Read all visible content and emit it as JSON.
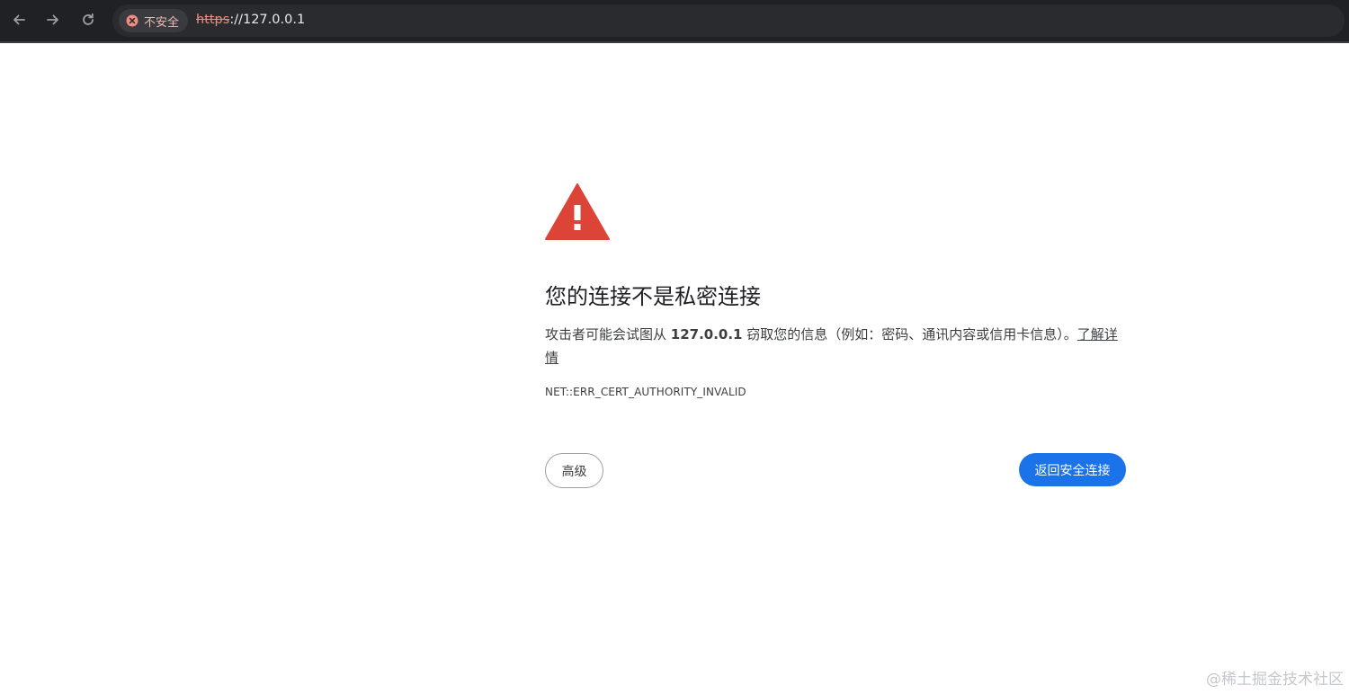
{
  "browser": {
    "security_label": "不安全",
    "url_scheme": "https",
    "url_separator": "://",
    "url_host": "127.0.0.1"
  },
  "page": {
    "heading": "您的连接不是私密连接",
    "desc_before": "攻击者可能会试图从 ",
    "desc_host": "127.0.0.1",
    "desc_after": " 窃取您的信息（例如：密码、通讯内容或信用卡信息）。",
    "learn_more": "了解详情",
    "error_code": "NET::ERR_CERT_AUTHORITY_INVALID",
    "advanced_button": "高级",
    "back_button": "返回安全连接"
  },
  "watermark": "@稀土掘金技术社区",
  "icons": {
    "back": "arrow-left-icon",
    "forward": "arrow-right-icon",
    "reload": "reload-icon",
    "security": "not-secure-icon",
    "warning": "warning-triangle-icon"
  },
  "colors": {
    "toolbar_bg": "#202124",
    "omnibox_bg": "#2a2b2e",
    "not_secure": "#f28b82",
    "warning_red": "#db4437",
    "primary_blue": "#1a73e8"
  }
}
